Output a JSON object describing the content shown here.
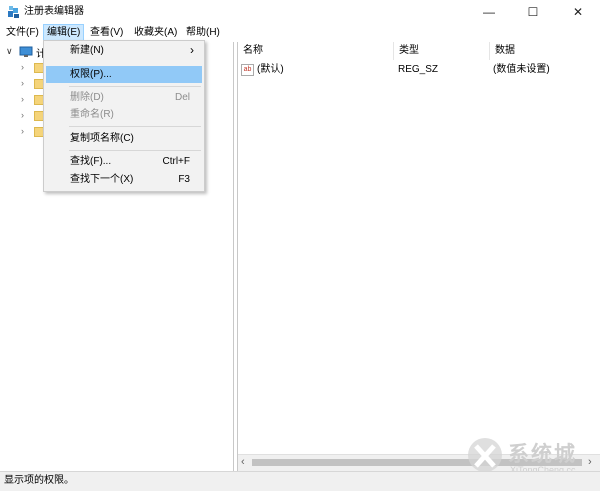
{
  "window": {
    "title": "注册表编辑器",
    "minimize_glyph": "—",
    "maximize_glyph": "☐",
    "close_glyph": "✕"
  },
  "menubar": {
    "file": "文件(F)",
    "edit": "编辑(E)",
    "view": "查看(V)",
    "favorites": "收藏夹(A)",
    "help": "帮助(H)"
  },
  "edit_menu": {
    "new": "新建(N)",
    "new_arrow": "›",
    "permissions": "权限(P)...",
    "delete": "删除(D)",
    "delete_shortcut": "Del",
    "rename": "重命名(R)",
    "copy_key_name": "复制项名称(C)",
    "find": "查找(F)...",
    "find_shortcut": "Ctrl+F",
    "find_next": "查找下一个(X)",
    "find_next_shortcut": "F3"
  },
  "tree": {
    "root_label": "计",
    "expand_glyph": "∨",
    "collapsed_glyph": "›"
  },
  "list": {
    "columns": {
      "name": "名称",
      "type": "类型",
      "data": "数据"
    },
    "rows": [
      {
        "icon_text": "ab",
        "name": "(默认)",
        "type": "REG_SZ",
        "data": "(数值未设置)"
      }
    ]
  },
  "scrollbar": {
    "left_arrow": "‹",
    "right_arrow": "›"
  },
  "status": {
    "text": "显示项的权限。"
  },
  "watermark": {
    "brand": "系统城",
    "url": "XiTongCheng.cc"
  },
  "colors": {
    "menu_active_bg": "#cce8ff",
    "menu_highlight": "#91c9f7",
    "disabled_text": "#8d8d8d",
    "folder": "#f5d47a"
  }
}
